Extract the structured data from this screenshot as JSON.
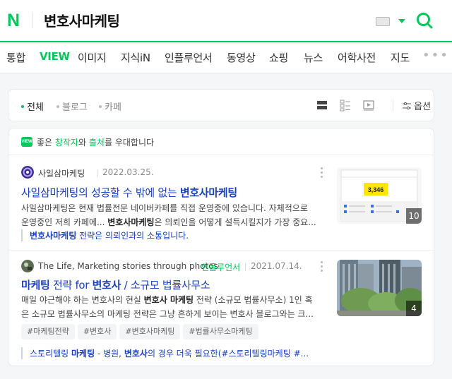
{
  "header": {
    "logo": "N",
    "query": "변호사마케팅",
    "icons": [
      "keyboard-icon",
      "chevron-down-icon",
      "search-icon"
    ],
    "accent": "#03c75a"
  },
  "tabs": [
    "통합",
    "VIEW",
    "이미지",
    "지식iN",
    "인플루언서",
    "동영상",
    "쇼핑",
    "뉴스",
    "어학사전",
    "지도",
    "•••"
  ],
  "active_tab": "VIEW",
  "filters": {
    "items": [
      "전체",
      "블로그",
      "카페"
    ],
    "active": "전체",
    "options_label": "옵션",
    "view_icons": [
      "list-view-icon",
      "grid-view-icon",
      "video-view-icon",
      "options-icon"
    ]
  },
  "notice": {
    "badge": "VIEW",
    "pre": "좋은 ",
    "creator": "창작자",
    "mid": "와 ",
    "source": "출처",
    "post": "를 우대합니다"
  },
  "posts": [
    {
      "author": "사일삼마케팅",
      "date": "2022.03.25.",
      "title_pre": "사일삼마케팅의 성공할 수 밖에 없는 ",
      "title_bold": "변호사마케팅",
      "desc_1a": "사일삼마케팅은 현재 법률전문 네이버카페를 직접 운영중에 있습니다. 자체적으로",
      "desc_2a": "운영중인 저희 카페에... ",
      "desc_2b": "변호사마케팅",
      "desc_2c": "은 의뢰인을 어떻게 설득시킬지가 가장 중요...",
      "quote_bold": "변호사마케팅",
      "quote_rest": " 전략은 의뢰인과의 소통입니다.",
      "thumb_count": "10",
      "thumb_value": "3,346"
    },
    {
      "author": "The Life, Marketing stories through photos",
      "badge": "인플루언서",
      "date": "2021.07.14.",
      "title_bold1": "마케팅",
      "title_mid": " 전략 for ",
      "title_bold2": "변호사",
      "title_rest": " / 소규모 법률사무소",
      "desc_1a": "매일 야근해야 하는 변호사의 현실 ",
      "desc_1b": "변호사 마케팅",
      "desc_1c": " 전략 (소규모 법률사무소) 1인 혹",
      "desc_2a": "은 소규모 법률사무소의 마케팅 전략은 그냥 흔하게 보이는 변호사 블로그와는 크...",
      "tags": [
        "#마케팅전략",
        "#변호사",
        "#변호사마케팅",
        "#법률사무소마케팅"
      ],
      "quote_a": "스토리텔링 ",
      "quote_b": "마케팅",
      "quote_c": " - 병원, ",
      "quote_d": "변호사",
      "quote_e": "의 경우 더욱 필요한(#스토리텔링마케팅 #...",
      "thumb_count": "4"
    }
  ]
}
